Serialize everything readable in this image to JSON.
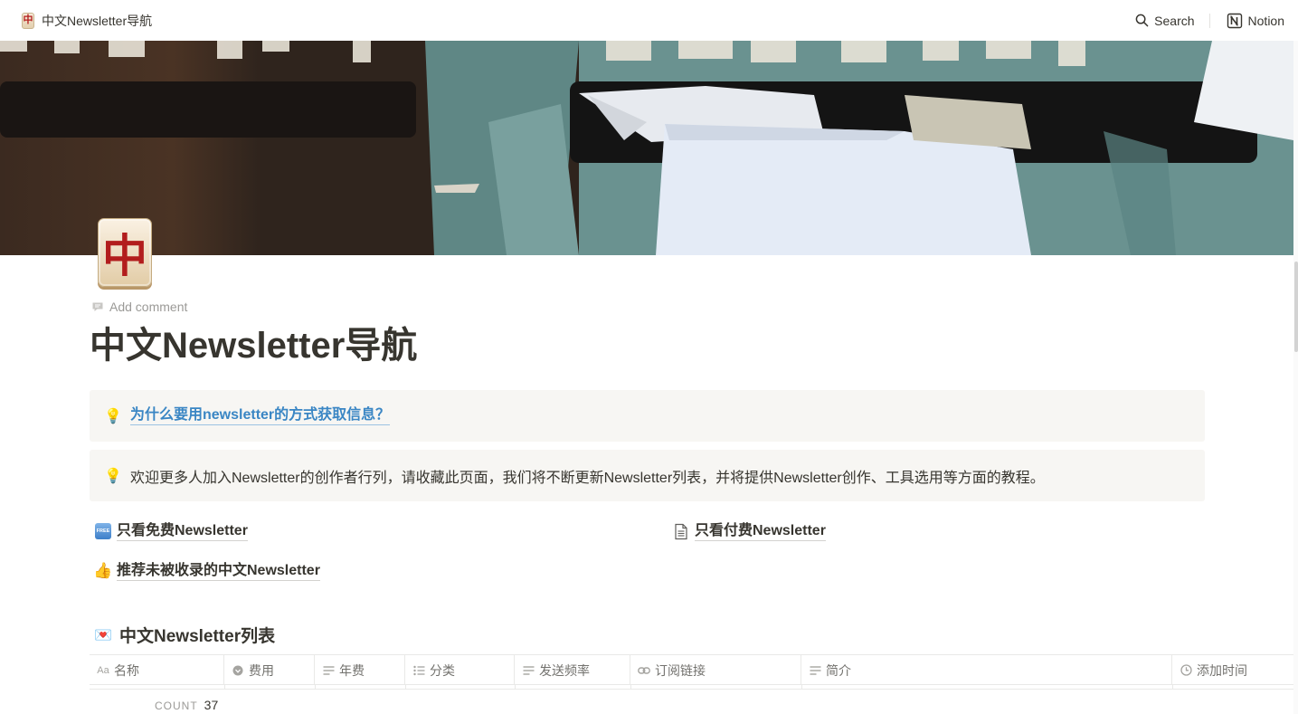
{
  "topbar": {
    "breadcrumb_title": "中文Newsletter导航",
    "breadcrumb_icon_char": "中",
    "search_label": "Search",
    "notion_label": "Notion"
  },
  "page": {
    "icon_char": "中",
    "add_comment": "Add comment",
    "title": "中文Newsletter导航"
  },
  "callouts": [
    {
      "icon": "💡",
      "text": "为什么要用newsletter的方式获取信息？",
      "is_link": true
    },
    {
      "icon": "💡",
      "text": "欢迎更多人加入Newsletter的创作者行列，请收藏此页面，我们将不断更新Newsletter列表，并将提供Newsletter创作、工具选用等方面的教程。",
      "is_link": false
    }
  ],
  "page_links": {
    "free": {
      "icon": "free-badge-icon",
      "badge_text": "FREE",
      "label": "只看免费Newsletter"
    },
    "paid": {
      "icon": "document-icon",
      "label": "只看付费Newsletter"
    },
    "recommend": {
      "icon": "👍",
      "label": "推荐未被收录的中文Newsletter"
    }
  },
  "database": {
    "icon": "💌",
    "title": "中文Newsletter列表",
    "columns": [
      {
        "icon": "text-aa-icon",
        "label": "名称"
      },
      {
        "icon": "select-icon",
        "label": "费用"
      },
      {
        "icon": "text-lines-icon",
        "label": "年费"
      },
      {
        "icon": "multi-select-icon",
        "label": "分类"
      },
      {
        "icon": "text-lines-icon",
        "label": "发送频率"
      },
      {
        "icon": "url-icon",
        "label": "订阅链接"
      },
      {
        "icon": "text-lines-icon",
        "label": "简介"
      },
      {
        "icon": "clock-icon",
        "label": "添加时间"
      }
    ],
    "count_label": "COUNT",
    "count_value": "37"
  },
  "colors": {
    "text": "#37352f",
    "muted": "#9b9a97",
    "link": "#3a86c4",
    "callout_bg": "#f7f6f3",
    "tile_red": "#b21d1d"
  }
}
